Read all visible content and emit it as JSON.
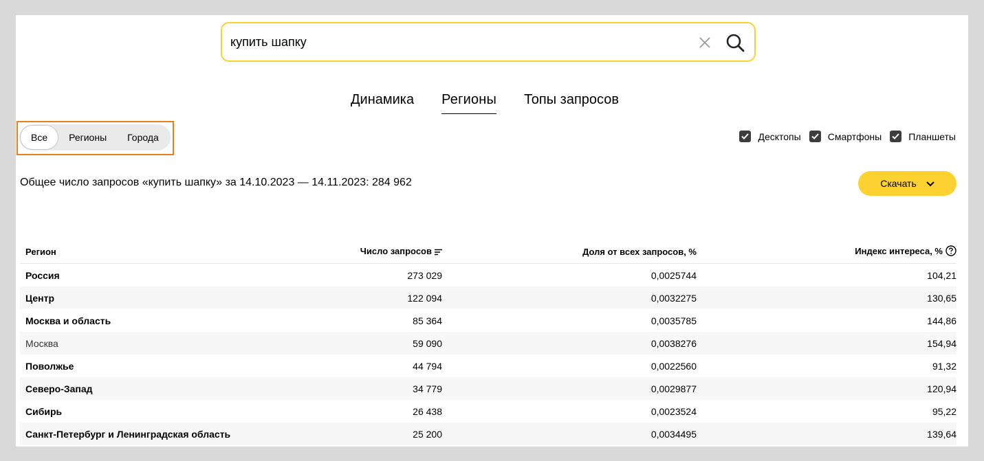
{
  "search": {
    "value": "купить шапку",
    "clear_icon": "close-icon",
    "search_icon": "search-icon",
    "accent_color": "#fcd130"
  },
  "tabs": [
    {
      "label": "Динамика",
      "active": false
    },
    {
      "label": "Регионы",
      "active": true
    },
    {
      "label": "Топы запросов",
      "active": false
    }
  ],
  "segments": [
    {
      "label": "Все",
      "active": true
    },
    {
      "label": "Регионы",
      "active": false
    },
    {
      "label": "Города",
      "active": false
    }
  ],
  "devices": [
    {
      "label": "Десктопы",
      "checked": true
    },
    {
      "label": "Смартфоны",
      "checked": true
    },
    {
      "label": "Планшеты",
      "checked": true
    }
  ],
  "summary": "Общее число запросов «купить шапку» за 14.10.2023 — 14.11.2023: 284 962",
  "download_label": "Скачать",
  "table": {
    "headers": {
      "region": "Регион",
      "count": "Число запросов",
      "share": "Доля от всех запросов, %",
      "index": "Индекс интереса, %"
    },
    "rows": [
      {
        "region": "Россия",
        "count": "273 029",
        "share": "0,0025744",
        "index": "104,21",
        "bold": true
      },
      {
        "region": "Центр",
        "count": "122 094",
        "share": "0,0032275",
        "index": "130,65",
        "bold": true
      },
      {
        "region": "Москва и область",
        "count": "85 364",
        "share": "0,0035785",
        "index": "144,86",
        "bold": true
      },
      {
        "region": "Москва",
        "count": "59 090",
        "share": "0,0038276",
        "index": "154,94",
        "bold": false
      },
      {
        "region": "Поволжье",
        "count": "44 794",
        "share": "0,0022560",
        "index": "91,32",
        "bold": true
      },
      {
        "region": "Северо-Запад",
        "count": "34 779",
        "share": "0,0029877",
        "index": "120,94",
        "bold": true
      },
      {
        "region": "Сибирь",
        "count": "26 438",
        "share": "0,0023524",
        "index": "95,22",
        "bold": true
      },
      {
        "region": "Санкт-Петербург и Ленинградская область",
        "count": "25 200",
        "share": "0,0034495",
        "index": "139,64",
        "bold": true
      }
    ]
  }
}
